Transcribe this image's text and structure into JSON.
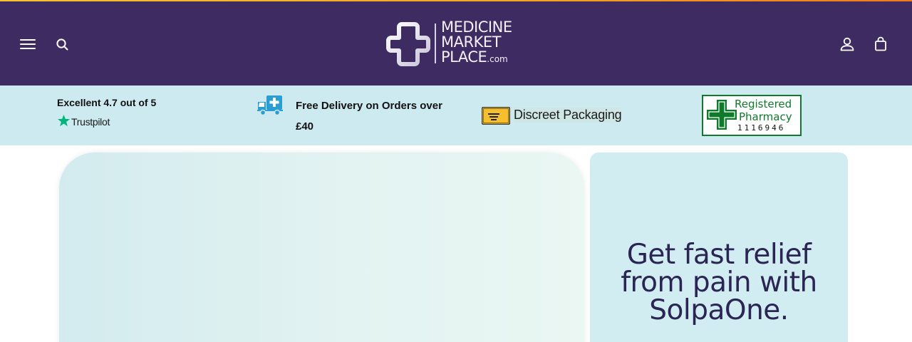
{
  "header": {
    "logo": {
      "line1": "MEDICINE",
      "line2": "MARKET",
      "line3": "PLACE",
      "suffix": ".com"
    },
    "icons": [
      "menu-icon",
      "search-icon",
      "account-icon",
      "cart-icon"
    ],
    "background_color": "#3d2b62"
  },
  "trust_bar": {
    "rating_text": "Excellent 4.7 out of 5",
    "trustpilot_label": "Trustpilot",
    "delivery_text": "Free Delivery on Orders over £40",
    "packaging_text": "Discreet Packaging",
    "registered_badge": {
      "line1": "Registered",
      "line2": "Pharmacy",
      "number": "1116946"
    },
    "background_color": "#cdeaf0"
  },
  "hero": {
    "promo_text": "Get fast relief from pain with SolpaOne."
  },
  "colors": {
    "accent_strip": "#f3a21f",
    "promo_text": "#2a2553",
    "trustpilot_green": "#00b67a",
    "pharmacy_green": "#0f7a2c"
  }
}
